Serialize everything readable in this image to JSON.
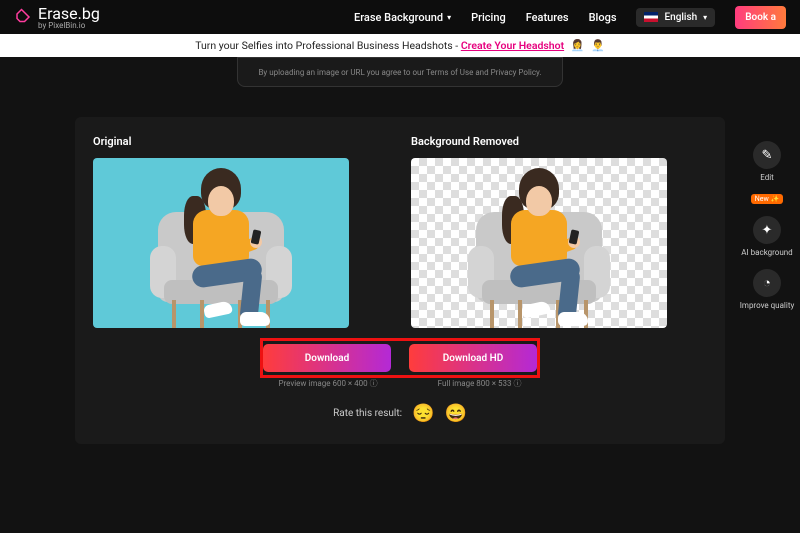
{
  "header": {
    "brand": "Erase.bg",
    "sub": "by PixelBin.io",
    "nav": {
      "erase": "Erase Background",
      "pricing": "Pricing",
      "features": "Features",
      "blogs": "Blogs"
    },
    "lang": "English",
    "cta": "Book a"
  },
  "banner": {
    "text": "Turn your Selfies into Professional Business Headshots - ",
    "link": "Create Your Headshot"
  },
  "stub_text": "By uploading an image or URL you agree to our Terms of Use and Privacy Policy.",
  "result": {
    "original_label": "Original",
    "removed_label": "Background Removed",
    "download": "Download",
    "download_hd": "Download HD",
    "preview_meta": "Preview image 600 × 400 ⓘ",
    "full_meta": "Full image 800 × 533 ⓘ",
    "rate_label": "Rate this result:"
  },
  "tools": {
    "edit": "Edit",
    "new_badge": "New ✨",
    "ai_bg": "AI background",
    "improve": "Improve quality"
  }
}
